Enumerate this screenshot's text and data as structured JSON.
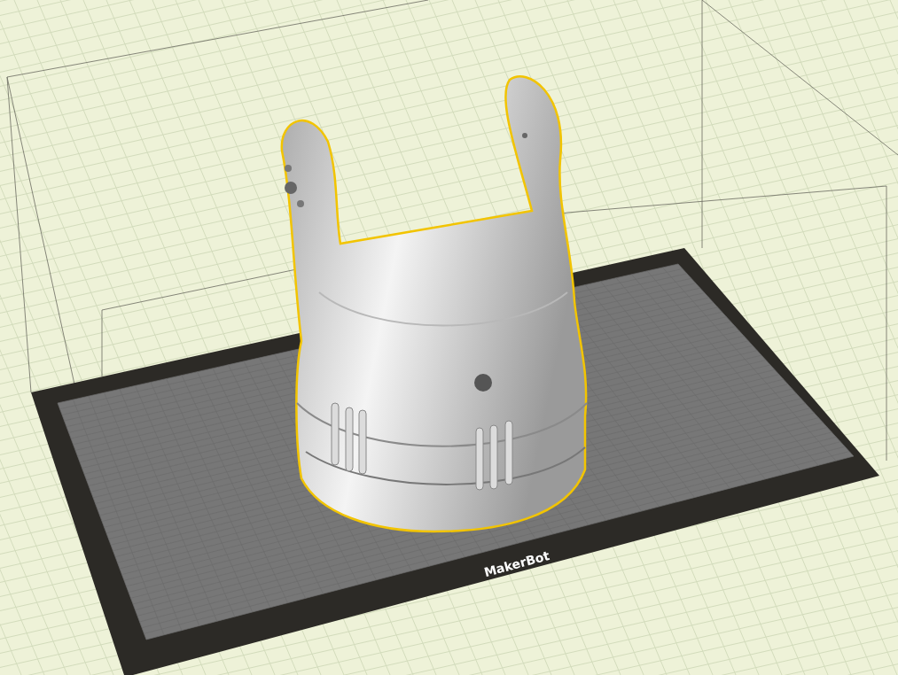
{
  "viewport": {
    "logo": "MakerBot",
    "model": {
      "selected": true
    }
  }
}
